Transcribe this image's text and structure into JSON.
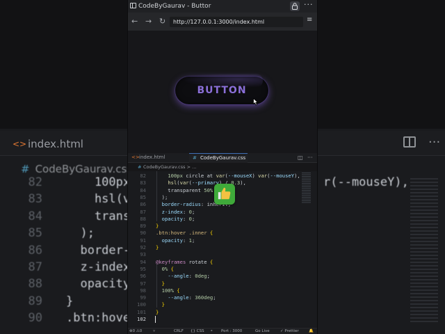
{
  "background": {
    "tab_label": "index.html",
    "breadcrumb": "CodeByGaurav.css",
    "lines": [
      {
        "num": "82",
        "text": "    100px",
        "tail": "r(--mouseY),"
      },
      {
        "num": "83",
        "text": "    hsl(va"
      },
      {
        "num": "84",
        "text": "    transp"
      },
      {
        "num": "85",
        "text": "  );"
      },
      {
        "num": "86",
        "text": "  border-r"
      },
      {
        "num": "87",
        "text": "  z-index:"
      },
      {
        "num": "88",
        "text": "  opacity:"
      },
      {
        "num": "89",
        "text": "}"
      },
      {
        "num": "90",
        "text": ".btn:hover"
      }
    ]
  },
  "browser": {
    "window_title": "CodeByGaurav - Buttor",
    "back_icon": "←",
    "forward_icon": "→",
    "reload_icon": "↻",
    "url": "http://127.0.0.1:3000/index.html",
    "more_icon": "···",
    "menu_icon": "≡"
  },
  "preview": {
    "button_label": "BUTTON"
  },
  "editor": {
    "tabs": [
      {
        "label": "index.html",
        "icon": "<>",
        "active": false
      },
      {
        "label": "CodeByGaurav.css",
        "icon": "#",
        "active": true
      }
    ],
    "breadcrumb": "CodeByGaurav.css > …",
    "lines": [
      {
        "num": "82",
        "html": "    100px circle at var(--mouseX) var(--mouseY),"
      },
      {
        "num": "83",
        "html": "    hsl(var(--primary) / 0.3),"
      },
      {
        "num": "84",
        "html": "    transparent 50%"
      },
      {
        "num": "85",
        "html": "  );"
      },
      {
        "num": "86",
        "html": "  border-radius: inherit;"
      },
      {
        "num": "87",
        "html": "  z-index: 0;"
      },
      {
        "num": "88",
        "html": "  opacity: 0;"
      },
      {
        "num": "89",
        "html": "}"
      },
      {
        "num": "90",
        "html": ".btn:hover .inner {"
      },
      {
        "num": "91",
        "html": "  opacity: 1;"
      },
      {
        "num": "92",
        "html": "}"
      },
      {
        "num": "93",
        "html": ""
      },
      {
        "num": "94",
        "html": "@keyframes rotate {"
      },
      {
        "num": "95",
        "html": "  0% {"
      },
      {
        "num": "96",
        "html": "    --angle: 0deg;"
      },
      {
        "num": "97",
        "html": "  }"
      },
      {
        "num": "98",
        "html": "  100% {"
      },
      {
        "num": "99",
        "html": "    --angle: 360deg;"
      },
      {
        "num": "100",
        "html": "  }"
      },
      {
        "num": "101",
        "html": "}"
      },
      {
        "num": "102",
        "html": ""
      }
    ]
  },
  "statusbar": {
    "problems": "⊗0 ⚠0",
    "ports": "⑂",
    "eol": "CRLF",
    "language": "{} CSS",
    "feedback": "⚬",
    "port": "Port : 3000",
    "golive": "Go Live",
    "prettier": "✓ Prettier",
    "bell": "🔔"
  },
  "colors": {
    "button_text": "#8b6fd9",
    "button_glow": "#8c64e6",
    "thumbs_up_bg": "#3faa3a",
    "tab_accent": "#3f6fb5"
  }
}
